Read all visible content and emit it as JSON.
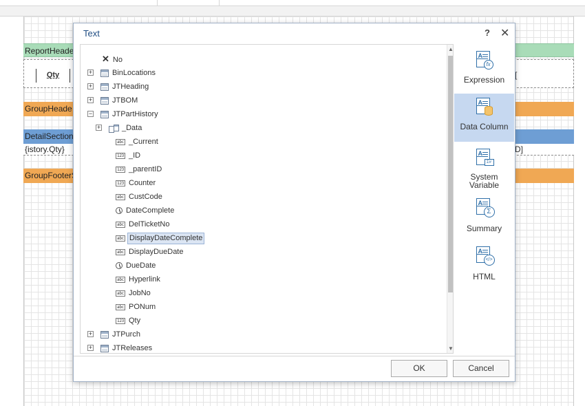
{
  "designer": {
    "bands": {
      "report_header": "ReportHeade",
      "group_header": "GroupHeade",
      "detail": "DetailSection",
      "group_footer": "GroupFooterS"
    },
    "qty_header": "Qty",
    "detail_text": "{istory.Qty}",
    "right_mark_header": "[",
    "right_mark_detail": "D]"
  },
  "dialog": {
    "title": "Text",
    "help": "?",
    "close": "✕",
    "tree": [
      {
        "label": "No",
        "kind": "none",
        "level": 0,
        "expander": ""
      },
      {
        "label": "BinLocations",
        "kind": "table",
        "level": 0,
        "expander": "+"
      },
      {
        "label": "JTHeading",
        "kind": "table",
        "level": 0,
        "expander": "+"
      },
      {
        "label": "JTBOM",
        "kind": "table",
        "level": 0,
        "expander": "+"
      },
      {
        "label": "JTPartHistory",
        "kind": "table",
        "level": 0,
        "expander": "−"
      },
      {
        "label": "_Data",
        "kind": "data",
        "level": 1,
        "expander": "+"
      },
      {
        "label": "_Current",
        "kind": "abc",
        "level": 2,
        "expander": ""
      },
      {
        "label": "_ID",
        "kind": "123",
        "level": 2,
        "expander": ""
      },
      {
        "label": "_parentID",
        "kind": "123",
        "level": 2,
        "expander": ""
      },
      {
        "label": "Counter",
        "kind": "123",
        "level": 2,
        "expander": ""
      },
      {
        "label": "CustCode",
        "kind": "abc",
        "level": 2,
        "expander": ""
      },
      {
        "label": "DateComplete",
        "kind": "clock",
        "level": 2,
        "expander": ""
      },
      {
        "label": "DelTicketNo",
        "kind": "abc",
        "level": 2,
        "expander": ""
      },
      {
        "label": "DisplayDateComplete",
        "kind": "abc",
        "level": 2,
        "expander": "",
        "selected": true
      },
      {
        "label": "DisplayDueDate",
        "kind": "abc",
        "level": 2,
        "expander": ""
      },
      {
        "label": "DueDate",
        "kind": "clock",
        "level": 2,
        "expander": ""
      },
      {
        "label": "Hyperlink",
        "kind": "abc",
        "level": 2,
        "expander": ""
      },
      {
        "label": "JobNo",
        "kind": "abc",
        "level": 2,
        "expander": ""
      },
      {
        "label": "PONum",
        "kind": "abc",
        "level": 2,
        "expander": ""
      },
      {
        "label": "Qty",
        "kind": "123",
        "level": 2,
        "expander": ""
      },
      {
        "label": "JTPurch",
        "kind": "table",
        "level": 0,
        "expander": "+"
      },
      {
        "label": "JTReleases",
        "kind": "table",
        "level": 0,
        "expander": "+"
      }
    ],
    "options": [
      {
        "label": "Expression",
        "icon": "expression-icon",
        "selected": false
      },
      {
        "label": "Data Column",
        "icon": "data-column-icon",
        "selected": true
      },
      {
        "label": "System\nVariable",
        "icon": "system-variable-icon",
        "selected": false
      },
      {
        "label": "Summary",
        "icon": "summary-icon",
        "selected": false
      },
      {
        "label": "HTML",
        "icon": "html-icon",
        "selected": false
      }
    ],
    "ok_label": "OK",
    "cancel_label": "Cancel",
    "icon_text": {
      "abc": "abc",
      "num": "123",
      "sys": "Σ#",
      "fx": "fx",
      "sum": "Σ",
      "html": "</>"
    }
  }
}
